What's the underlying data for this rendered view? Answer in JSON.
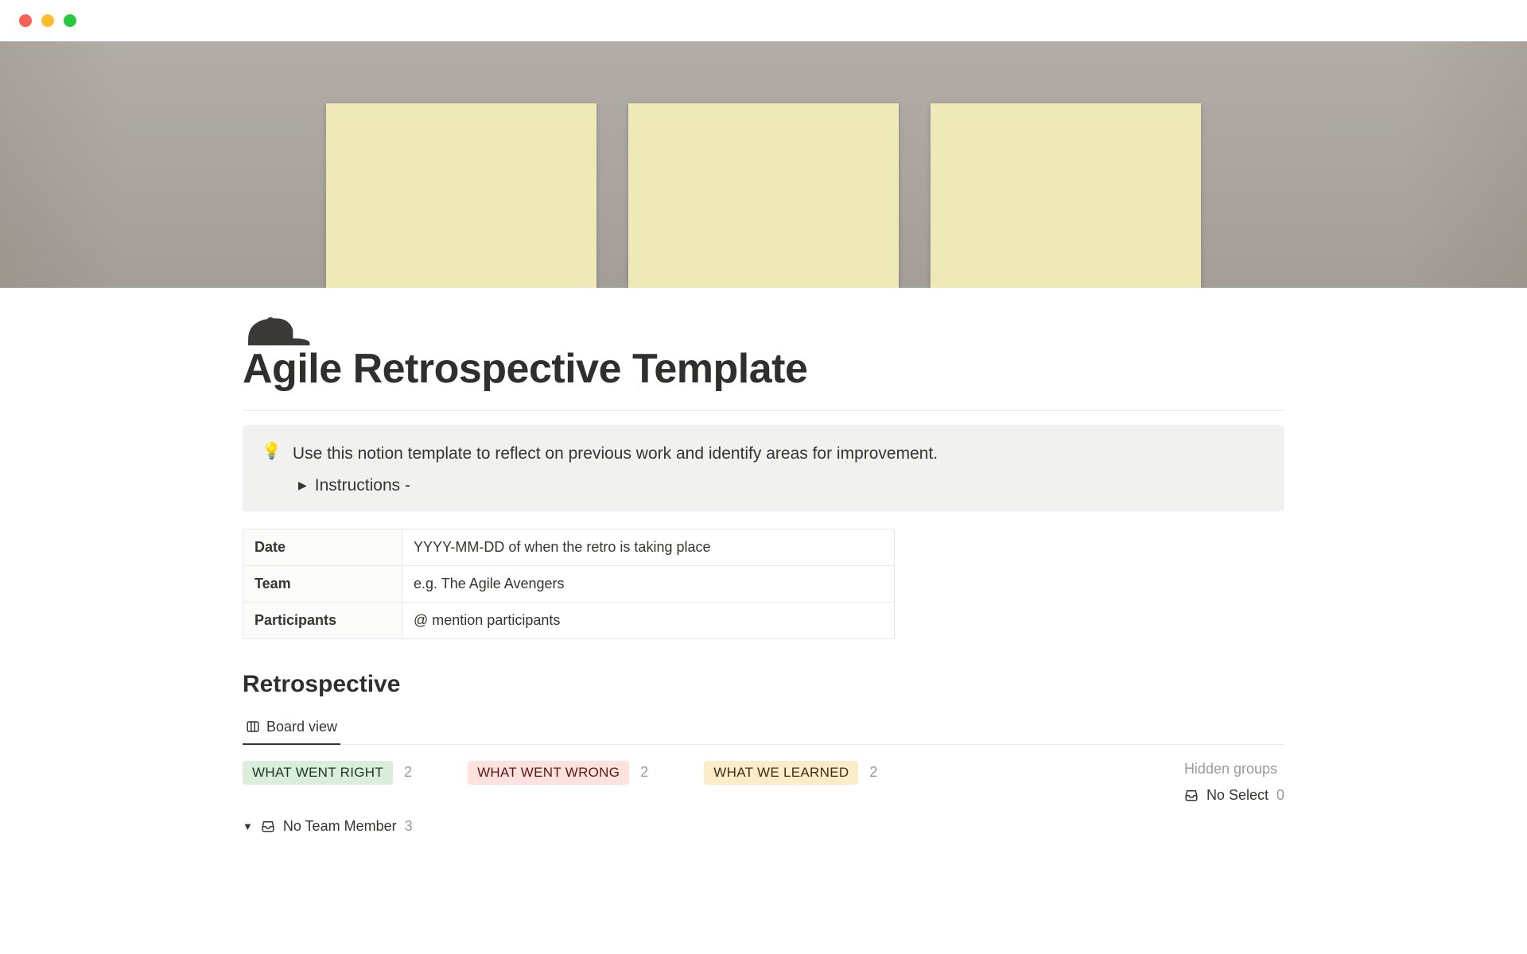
{
  "page": {
    "title": "Agile Retrospective Template",
    "icon": "cap"
  },
  "callout": {
    "icon": "💡",
    "text": "Use this notion template to reflect on previous work and identify areas for improvement.",
    "toggle_label": "Instructions -"
  },
  "info_table": [
    {
      "key": "Date",
      "value": "YYYY-MM-DD of when the retro is taking place"
    },
    {
      "key": "Team",
      "value": "e.g. The Agile Avengers"
    },
    {
      "key": "Participants",
      "value": "@ mention participants"
    }
  ],
  "retro": {
    "heading": "Retrospective",
    "view_label": "Board view",
    "columns": [
      {
        "label": "WHAT WENT RIGHT",
        "count": 2,
        "color": "green"
      },
      {
        "label": "WHAT WENT WRONG",
        "count": 2,
        "color": "red"
      },
      {
        "label": "WHAT WE LEARNED",
        "count": 2,
        "color": "yellow"
      }
    ],
    "hidden": {
      "title": "Hidden groups",
      "item_label": "No Select",
      "item_count": 0
    },
    "subgroup": {
      "label": "No Team Member",
      "count": 3
    }
  }
}
